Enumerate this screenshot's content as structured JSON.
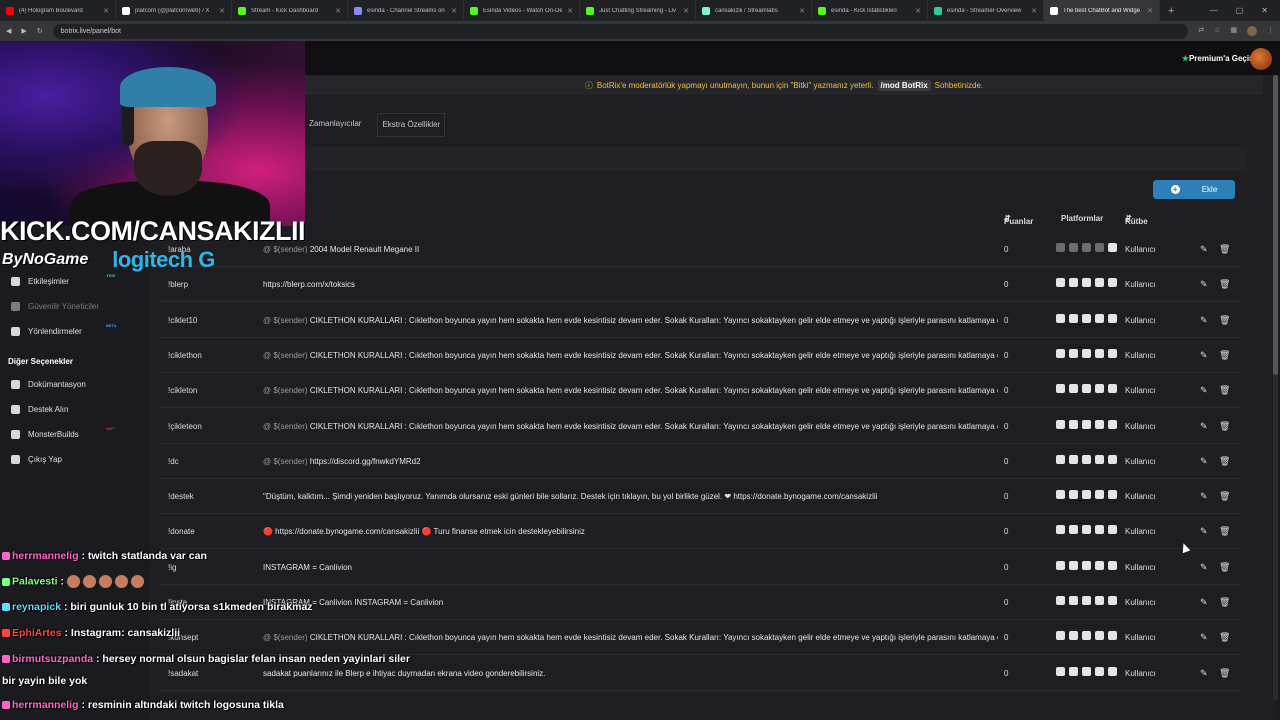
{
  "browser": {
    "tabs": [
      {
        "title": "(4) Hologram Boulevard",
        "color": "#ff0000"
      },
      {
        "title": "platcorn (@platcornweb) / X",
        "color": "#ffffff"
      },
      {
        "title": "Stream - Kick Dashboard",
        "color": "#53fc18"
      },
      {
        "title": "esinda - Channel Streams on",
        "color": "#8a8aff"
      },
      {
        "title": "Esinda Videos - Watch On-De",
        "color": "#53fc18"
      },
      {
        "title": "Just Chatting Streaming - Liv",
        "color": "#53fc18"
      },
      {
        "title": "cansakizlii / Streamlabs",
        "color": "#80f5d2"
      },
      {
        "title": "esinda - Kick İstatistikleri",
        "color": "#53fc18"
      },
      {
        "title": "esinda - Streamer Overview",
        "color": "#2ecc9a"
      },
      {
        "title": "The best ChatBot and Widge",
        "color": "#ffffff"
      }
    ],
    "url": "botrix.live/panel/bot"
  },
  "header": {
    "premium_label": "Premium'a Geçin"
  },
  "notice": {
    "text_before": "BotRix'e moderatörlük yapmayı unutmayın, bunun için \"Bitki\" yazmanız yeterli.",
    "command": "/mod BotRix",
    "text_after": "Sohbetinizde."
  },
  "subtabs": [
    "Zamanlayıcılar",
    "Ekstra Özellikler"
  ],
  "add_button": "Ekle",
  "table": {
    "columns": {
      "points": "Puanlar",
      "platforms": "Platformlar",
      "rank": "Rütbe"
    },
    "rows": [
      {
        "cmd": "!araba",
        "sender": "@ $(sender)",
        "resp": "2004 Model Renault Megane II",
        "pts": "0",
        "rank": "Kullanıcı"
      },
      {
        "cmd": "!blerp",
        "sender": "",
        "resp": "https://blerp.com/x/toksics",
        "pts": "0",
        "rank": "Kullanıcı"
      },
      {
        "cmd": "!ciklet10",
        "sender": "@ $(sender)",
        "resp": "CIKLETHON KURALLARI : Cıklethon boyunca yayın hem sokakta hem evde kesintisiz devam eder. Sokak Kuralları: Yayıncı sokaktayken gelir elde etmeye ve yaptığı işleriyle parasını katlamaya çalışır. Y",
        "pts": "0",
        "rank": "Kullanıcı"
      },
      {
        "cmd": "!ciklethon",
        "sender": "@ $(sender)",
        "resp": "CIKLETHON KURALLARI : Cıklethon boyunca yayın hem sokakta hem evde kesintisiz devam eder. Sokak Kuralları: Yayıncı sokaktayken gelir elde etmeye ve yaptığı işleriyle parasını katlamaya çalışır. Y",
        "pts": "0",
        "rank": "Kullanıcı"
      },
      {
        "cmd": "!cikleton",
        "sender": "@ $(sender)",
        "resp": "CIKLETHON KURALLARI : Cıklethon boyunca yayın hem sokakta hem evde kesintisiz devam eder. Sokak Kuralları: Yayıncı sokaktayken gelir elde etmeye ve yaptığı işleriyle parasını katlamaya çalışır. Y",
        "pts": "0",
        "rank": "Kullanıcı"
      },
      {
        "cmd": "!çikleteon",
        "sender": "@ $(sender)",
        "resp": "CIKLETHON KURALLARI : Cıklethon boyunca yayın hem sokakta hem evde kesintisiz devam eder. Sokak Kuralları: Yayıncı sokaktayken gelir elde etmeye ve yaptığı işleriyle parasını katlamaya çalışır. Y",
        "pts": "0",
        "rank": "Kullanıcı"
      },
      {
        "cmd": "!dc",
        "sender": "@ $(sender)",
        "resp": "https://discord.gg/fnwkdYMRd2",
        "pts": "0",
        "rank": "Kullanıcı"
      },
      {
        "cmd": "!destek",
        "sender": "",
        "resp": "\"Düştüm, kalktım... Şimdi yeniden başlıyoruz. Yanımda olursanız eski günleri bile sollarız. Destek için tıklayın, bu yol birlikte güzel. ❤ https://donate.bynogame.com/cansakizlii",
        "pts": "0",
        "rank": "Kullanıcı"
      },
      {
        "cmd": "!donate",
        "sender": "",
        "resp": "🔴 https://donate.bynogame.com/cansakizlii 🔴 Turu finanse etmek icin destekleyebilirsiniz",
        "pts": "0",
        "rank": "Kullanıcı"
      },
      {
        "cmd": "!ig",
        "sender": "",
        "resp": "INSTAGRAM = Canlivion",
        "pts": "0",
        "rank": "Kullanıcı"
      },
      {
        "cmd": "!insta",
        "sender": "",
        "resp": "INSTAGRAM = Canlivion INSTAGRAM = Canlivion",
        "pts": "0",
        "rank": "Kullanıcı"
      },
      {
        "cmd": "!konsept",
        "sender": "@ $(sender)",
        "resp": "CIKLETHON KURALLARI : Cıklethon boyunca yayın hem sokakta hem evde kesintisiz devam eder. Sokak Kuralları: Yayıncı sokaktayken gelir elde etmeye ve yaptığı işleriyle parasını katlamaya çalışır. Y",
        "pts": "0",
        "rank": "Kullanıcı"
      },
      {
        "cmd": "!sadakat",
        "sender": "",
        "resp": "sadakat puanlarınız ile Blerp e ihtiyac duymadan ekrana video gonderebilirsiniz.",
        "pts": "0",
        "rank": "Kullanıcı"
      }
    ]
  },
  "sidebar": {
    "items": [
      {
        "label": "Etkileşimler",
        "badge": "YENİ",
        "badge_color": "#2ecc71"
      },
      {
        "label": "Güvenilir Yöneticiler",
        "badge": "",
        "badge_color": ""
      },
      {
        "label": "Yönlendirmeler",
        "badge": "BETA",
        "badge_color": "#3fa0e0"
      }
    ],
    "other_heading": "Diğer Seçenekler",
    "other_items": [
      {
        "label": "Dokümantasyon",
        "badge": "",
        "badge_color": ""
      },
      {
        "label": "Destek Alın",
        "badge": "",
        "badge_color": ""
      },
      {
        "label": "MonsterBuilds",
        "badge": "HOT",
        "badge_color": "#e03040"
      },
      {
        "label": "Çıkış Yap",
        "badge": "",
        "badge_color": ""
      }
    ]
  },
  "overlay": {
    "kick_text": "KICK.COM/CANSAKIZLII",
    "sponsor1": "ByNoGame",
    "sponsor2": "logitech G"
  },
  "chat": [
    {
      "user": "herrmannelig",
      "user_color": "#ff66cc",
      "msg": ": twitch statlanda var can",
      "emotes": 0
    },
    {
      "user": "Palavesti",
      "user_color": "#7fff7f",
      "msg": ":",
      "emotes": 5
    },
    {
      "user": "reynapick",
      "user_color": "#66d9ff",
      "msg": ": biri gunluk 10 bin tl atiyorsa s1kmeden birakmaz",
      "emotes": 0
    },
    {
      "user": "EphiArtes",
      "user_color": "#ff4444",
      "msg": ": Instagram: cansakizlii",
      "emotes": 0
    },
    {
      "user": "birmutsuzpanda",
      "user_color": "#ff66cc",
      "msg": ": hersey normal olsun bagislar felan insan neden yayinlari siler",
      "emotes": 0
    },
    {
      "user": "",
      "user_color": "#ffffff",
      "msg": "bir yayin bile yok",
      "emotes": 0
    },
    {
      "user": "herrmannelig",
      "user_color": "#ff66cc",
      "msg": ": resminin altındaki twitch logosuna tikla",
      "emotes": 0
    }
  ]
}
